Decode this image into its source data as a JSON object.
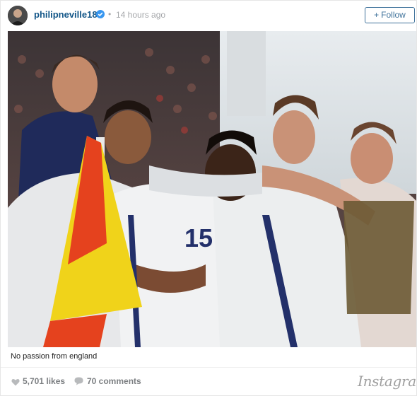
{
  "post": {
    "username": "philipneville18",
    "separator": "•",
    "time": "14 hours ago",
    "follow_label": "Follow",
    "follow_plus": "+",
    "caption": "No passion from england",
    "likes": "5,701 likes",
    "comments": "70 comments",
    "brand": "Instagram"
  },
  "photo": {
    "shirt_number": "15"
  },
  "icons": {
    "verified": "verified-badge-icon",
    "like": "heart-icon",
    "comment": "speech-bubble-icon",
    "follow": "plus-icon"
  },
  "colors": {
    "username": "#125688",
    "follow_border": "#3f729b",
    "verified": "#3897f0",
    "meta": "#a5a7aa",
    "footer_text": "#7c7f82"
  }
}
